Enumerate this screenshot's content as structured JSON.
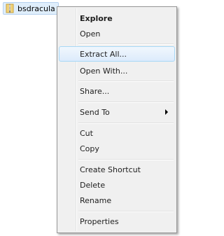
{
  "file": {
    "name": "bsdracula",
    "icon": "zip-folder-icon"
  },
  "menu": {
    "items": [
      {
        "label": "Explore"
      },
      {
        "label": "Open"
      },
      {
        "label": "Extract All..."
      },
      {
        "label": "Open With..."
      },
      {
        "label": "Share..."
      },
      {
        "label": "Send To"
      },
      {
        "label": "Cut"
      },
      {
        "label": "Copy"
      },
      {
        "label": "Create Shortcut"
      },
      {
        "label": "Delete"
      },
      {
        "label": "Rename"
      },
      {
        "label": "Properties"
      }
    ],
    "hovered_item": "Extract All...",
    "submenu_arrow_icon": "chevron-right-icon"
  }
}
